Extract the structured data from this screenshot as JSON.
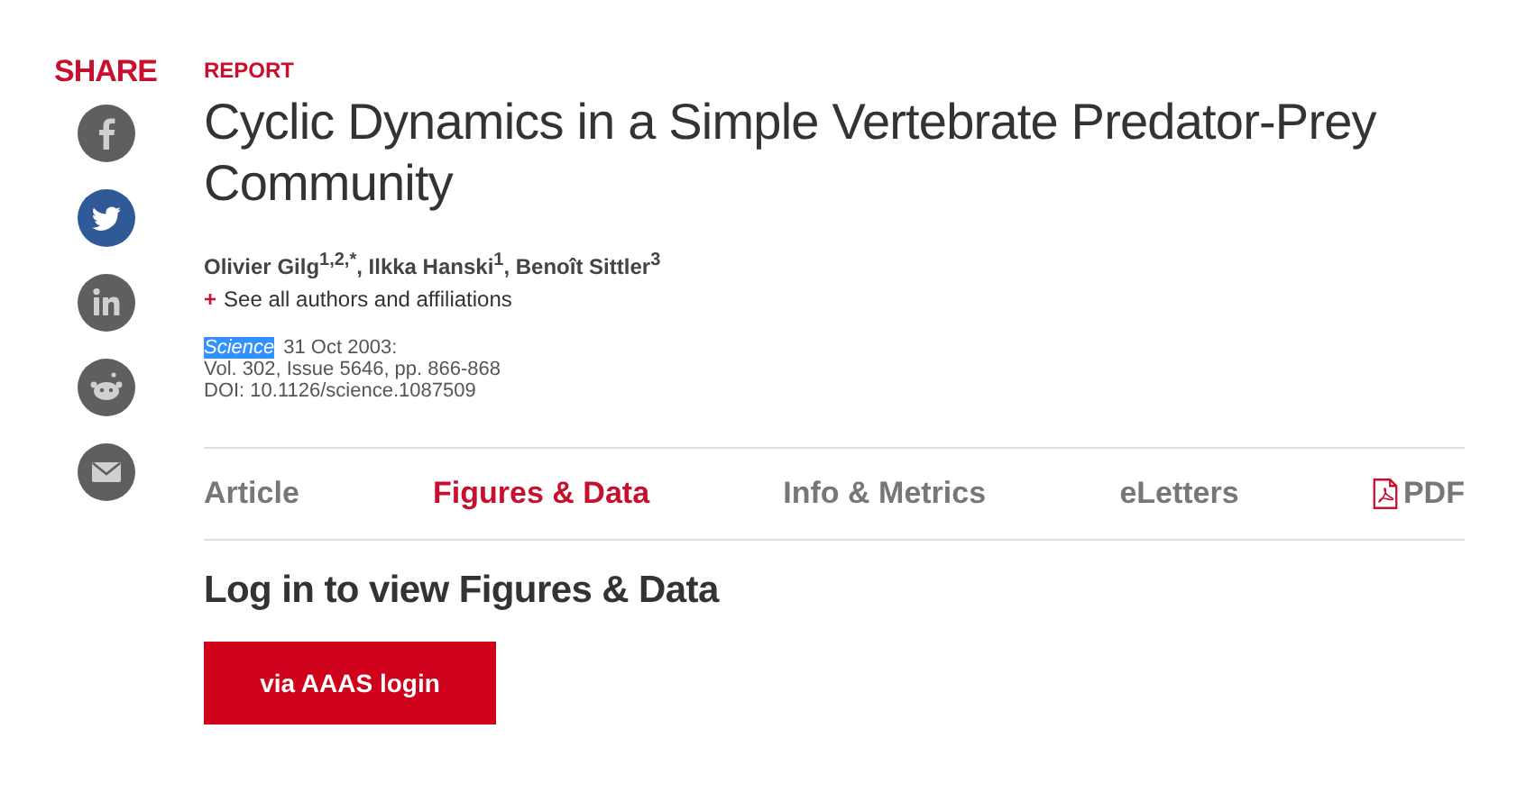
{
  "share": {
    "label": "SHARE",
    "icons": [
      {
        "kind": "facebook",
        "color": "#5f5f5f"
      },
      {
        "kind": "twitter",
        "color": "#2f5a97"
      },
      {
        "kind": "linkedin",
        "color": "#5f5f5f"
      },
      {
        "kind": "reddit",
        "color": "#5f5f5f"
      },
      {
        "kind": "email",
        "color": "#5f5f5f"
      }
    ]
  },
  "article": {
    "type": "REPORT",
    "title": "Cyclic Dynamics in a Simple Vertebrate Predator-Prey Community",
    "authors": "Olivier Gilg$^{1,2,*}$, Ilkka Hanski$^{1}$, Benoît Sittler$^{3}$",
    "affiliations_toggle": "+",
    "affiliations_label": "See all authors and affiliations",
    "journal": {
      "text": "Science",
      "highlighted": true
    },
    "date": "31 Oct 2003:",
    "volume": "Vol. 302, Issue 5646, pp. 866-868",
    "doi": "DOI: 10.1126/science.1087509"
  },
  "tabs": [
    {
      "label": "Article",
      "selected": false,
      "kind": "text"
    },
    {
      "label": "Figures & Data",
      "selected": true,
      "kind": "text"
    },
    {
      "label": "Info & Metrics",
      "selected": false,
      "kind": "text"
    },
    {
      "label": "eLetters",
      "selected": false,
      "kind": "text"
    },
    {
      "label": "PDF",
      "selected": false,
      "kind": "pdf"
    }
  ],
  "login": {
    "heading": "Log in to view Figures & Data",
    "button": "via AAAS login"
  }
}
